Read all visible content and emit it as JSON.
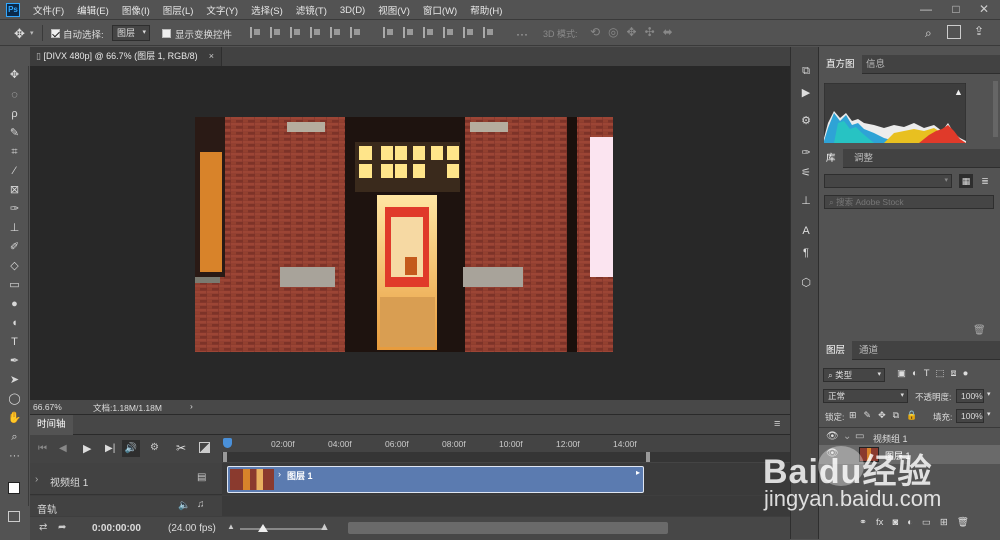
{
  "menubar": {
    "logo": "Ps",
    "items": [
      "文件(F)",
      "编辑(E)",
      "图像(I)",
      "图层(L)",
      "文字(Y)",
      "选择(S)",
      "滤镜(T)",
      "3D(D)",
      "视图(V)",
      "窗口(W)",
      "帮助(H)"
    ],
    "minimize": "—",
    "maximize": "□",
    "close": "✕"
  },
  "options": {
    "auto_select_label": "自动选择:",
    "auto_select_value": "图层",
    "show_transform_label": "显示变换控件",
    "mode3d_label": "3D 模式:"
  },
  "document": {
    "tab_title": "[DIVX 480p] @ 66.7% (图层 1, RGB/8)",
    "close": "×"
  },
  "status": {
    "zoom": "66.67%",
    "doc_info": "文档:1.18M/1.18M",
    "arrow": "›"
  },
  "timeline": {
    "panel_title": "时间轴",
    "ruler_ticks": [
      "02:00f",
      "04:00f",
      "06:00f",
      "08:00f",
      "10:00f",
      "12:00f",
      "14:00f"
    ],
    "video_group_label": "视频组 1",
    "clip_label": "图层 1",
    "audio_label": "音轨",
    "timecode": "0:00:00:00",
    "fps": "(24.00 fps)"
  },
  "histogram_panel": {
    "tabs": [
      "直方图",
      "信息"
    ],
    "warning": "▲"
  },
  "library_panel": {
    "tabs": [
      "库",
      "调整"
    ],
    "search_placeholder": "搜索 Adobe Stock"
  },
  "layers_panel": {
    "tabs": [
      "图层",
      "通道"
    ],
    "filter_label": "类型",
    "blend_mode": "正常",
    "opacity_label": "不透明度:",
    "opacity_value": "100%",
    "lock_label": "锁定:",
    "fill_label": "填充:",
    "fill_value": "100%",
    "group_name": "视频组 1",
    "layer_name": "图层 1"
  },
  "watermark": {
    "text": "Baidu经验",
    "url": "jingyan.baidu.com"
  },
  "colors": {
    "ui_bg": "#535353",
    "canvas_bg": "#282828",
    "clip_blue": "#5b7bb0",
    "playhead": "#4a90d9"
  }
}
